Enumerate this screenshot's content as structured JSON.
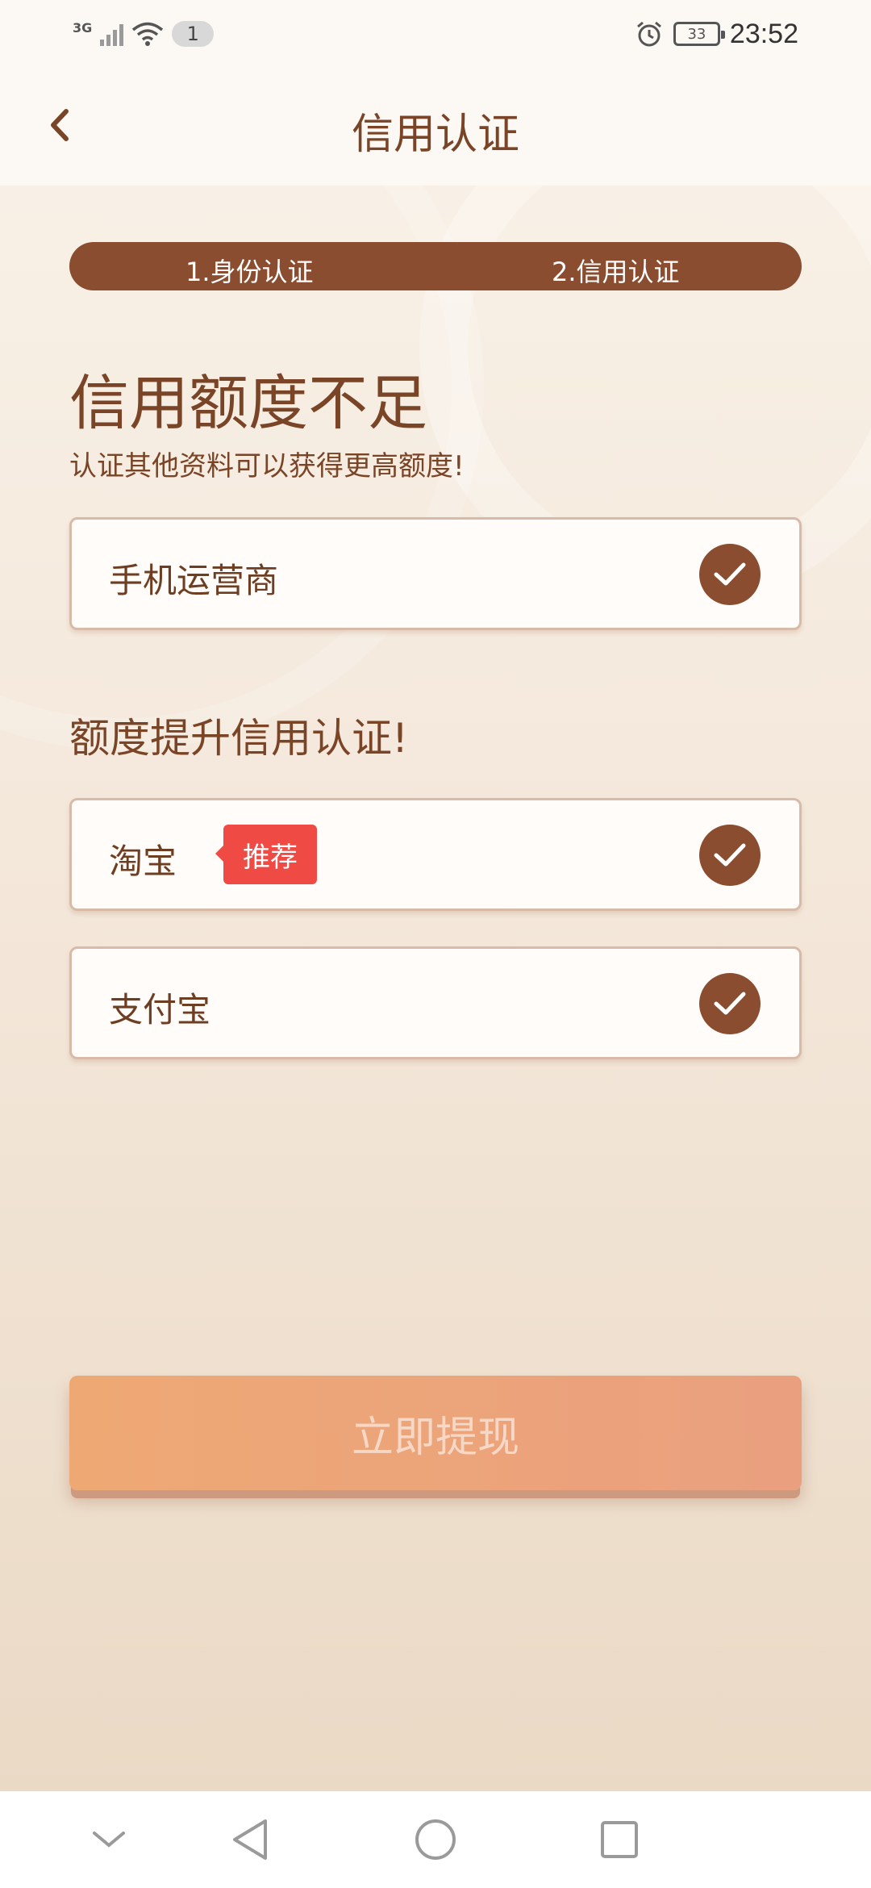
{
  "status_bar": {
    "network": "3G",
    "notification_count": "1",
    "battery": "33",
    "time": "23:52"
  },
  "header": {
    "title": "信用认证"
  },
  "steps": [
    {
      "label": "1.身份认证"
    },
    {
      "label": "2.信用认证"
    }
  ],
  "main": {
    "headline": "信用额度不足",
    "subline": "认证其他资料可以获得更高额度!",
    "verified_items": [
      {
        "label": "手机运营商"
      }
    ],
    "section_title": "额度提升信用认证!",
    "boost_items": [
      {
        "label": "淘宝",
        "badge": "推荐"
      },
      {
        "label": "支付宝"
      }
    ],
    "cta_label": "立即提现"
  },
  "icons": {
    "back": "chevron-left-icon",
    "check": "checkmark-icon",
    "nav": [
      "chevron-down-icon",
      "back-triangle-icon",
      "home-circle-icon",
      "recents-square-icon"
    ]
  },
  "colors": {
    "primary_brown": "#8a4d30",
    "badge_red": "#f04a45",
    "cta_orange": "#eea874"
  }
}
